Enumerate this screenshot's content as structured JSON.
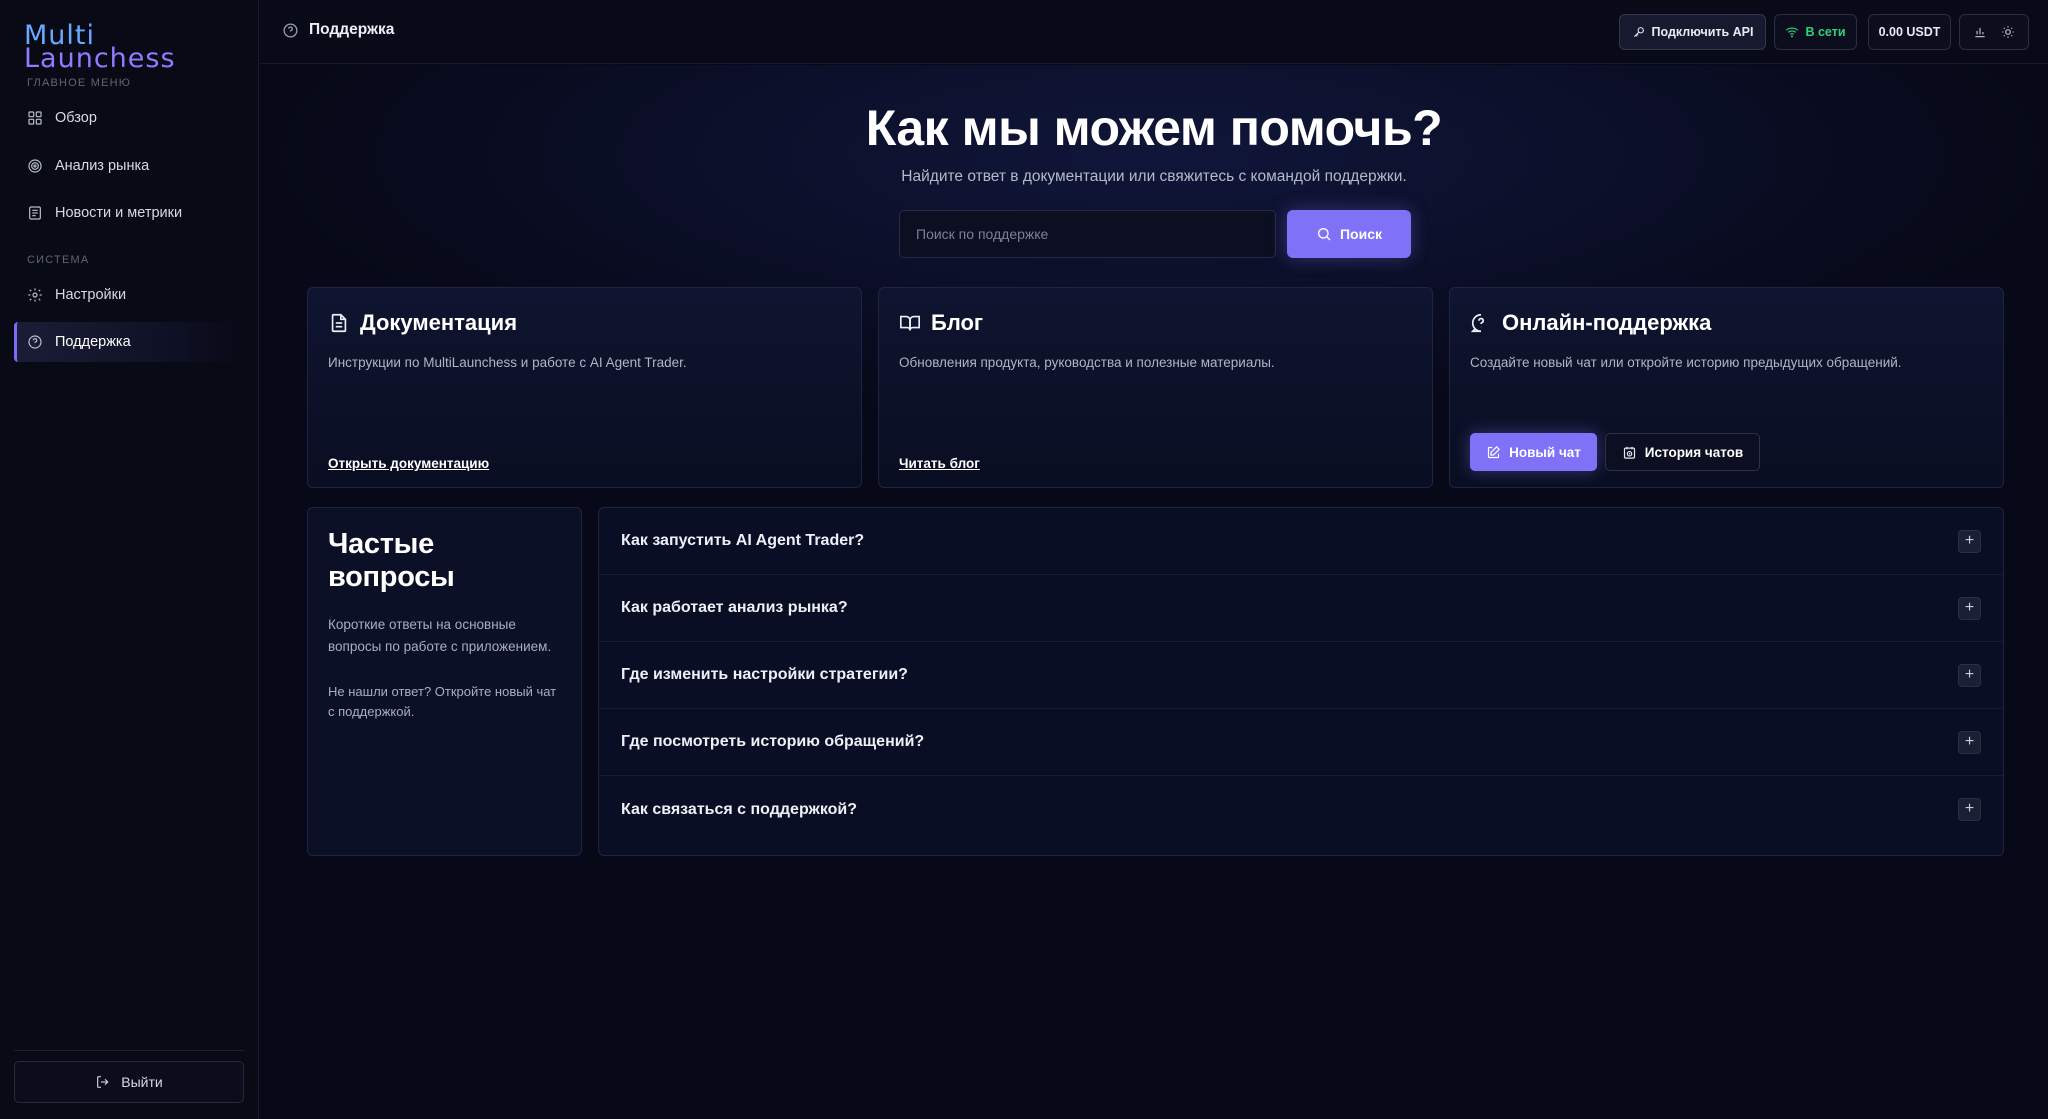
{
  "sidebar": {
    "logo_top": "Multi",
    "logo_bottom": "Launchess",
    "main_section": "ГЛАВНОЕ МЕНЮ",
    "system_section": "СИСТЕМА",
    "items": [
      {
        "label": "Обзор",
        "icon": "grid-icon"
      },
      {
        "label": "Анализ рынка",
        "icon": "target-icon"
      },
      {
        "label": "Новости и метрики",
        "icon": "newspaper-icon"
      },
      {
        "label": "Настройки",
        "icon": "gear-icon"
      },
      {
        "label": "Поддержка",
        "icon": "help-circle-icon",
        "active": true
      }
    ],
    "logout_label": "Выйти"
  },
  "topbar": {
    "page_title": "Поддержка",
    "api_label": "Подключить API",
    "status_label": "В сети",
    "balance_label": "0.00 USDT"
  },
  "hero": {
    "title": "Как мы можем помочь?",
    "subtitle": "Найдите ответ в документации или свяжитесь с командой поддержки.",
    "search_placeholder": "Поиск по поддержке",
    "search_value": "",
    "search_button": "Поиск"
  },
  "cards": [
    {
      "title": "Документация",
      "desc": "Инструкции по MultiLaunchess и работе с AI Agent Trader.",
      "link": "Открыть документацию"
    },
    {
      "title": "Блог",
      "desc": "Обновления продукта, руководства и полезные материалы.",
      "link": "Читать блог"
    },
    {
      "title": "Онлайн-поддержка",
      "desc": "Создайте новый чат или откройте историю предыдущих обращений.",
      "new_chat": "Новый чат",
      "history": "История чатов"
    }
  ],
  "faq": {
    "title": "Частые вопросы",
    "desc": "Короткие ответы на основные вопросы по работе с приложением.",
    "note": "Не нашли ответ? Откройте новый чат с поддержкой.",
    "items": [
      "Как запустить AI Agent Trader?",
      "Как работает анализ рынка?",
      "Где изменить настройки стратегии?",
      "Где посмотреть историю обращений?",
      "Как связаться с поддержкой?"
    ],
    "expand_symbol": "+"
  },
  "colors": {
    "accent": "#7f72f7",
    "online": "#2fd27a",
    "background": "#07091a"
  }
}
